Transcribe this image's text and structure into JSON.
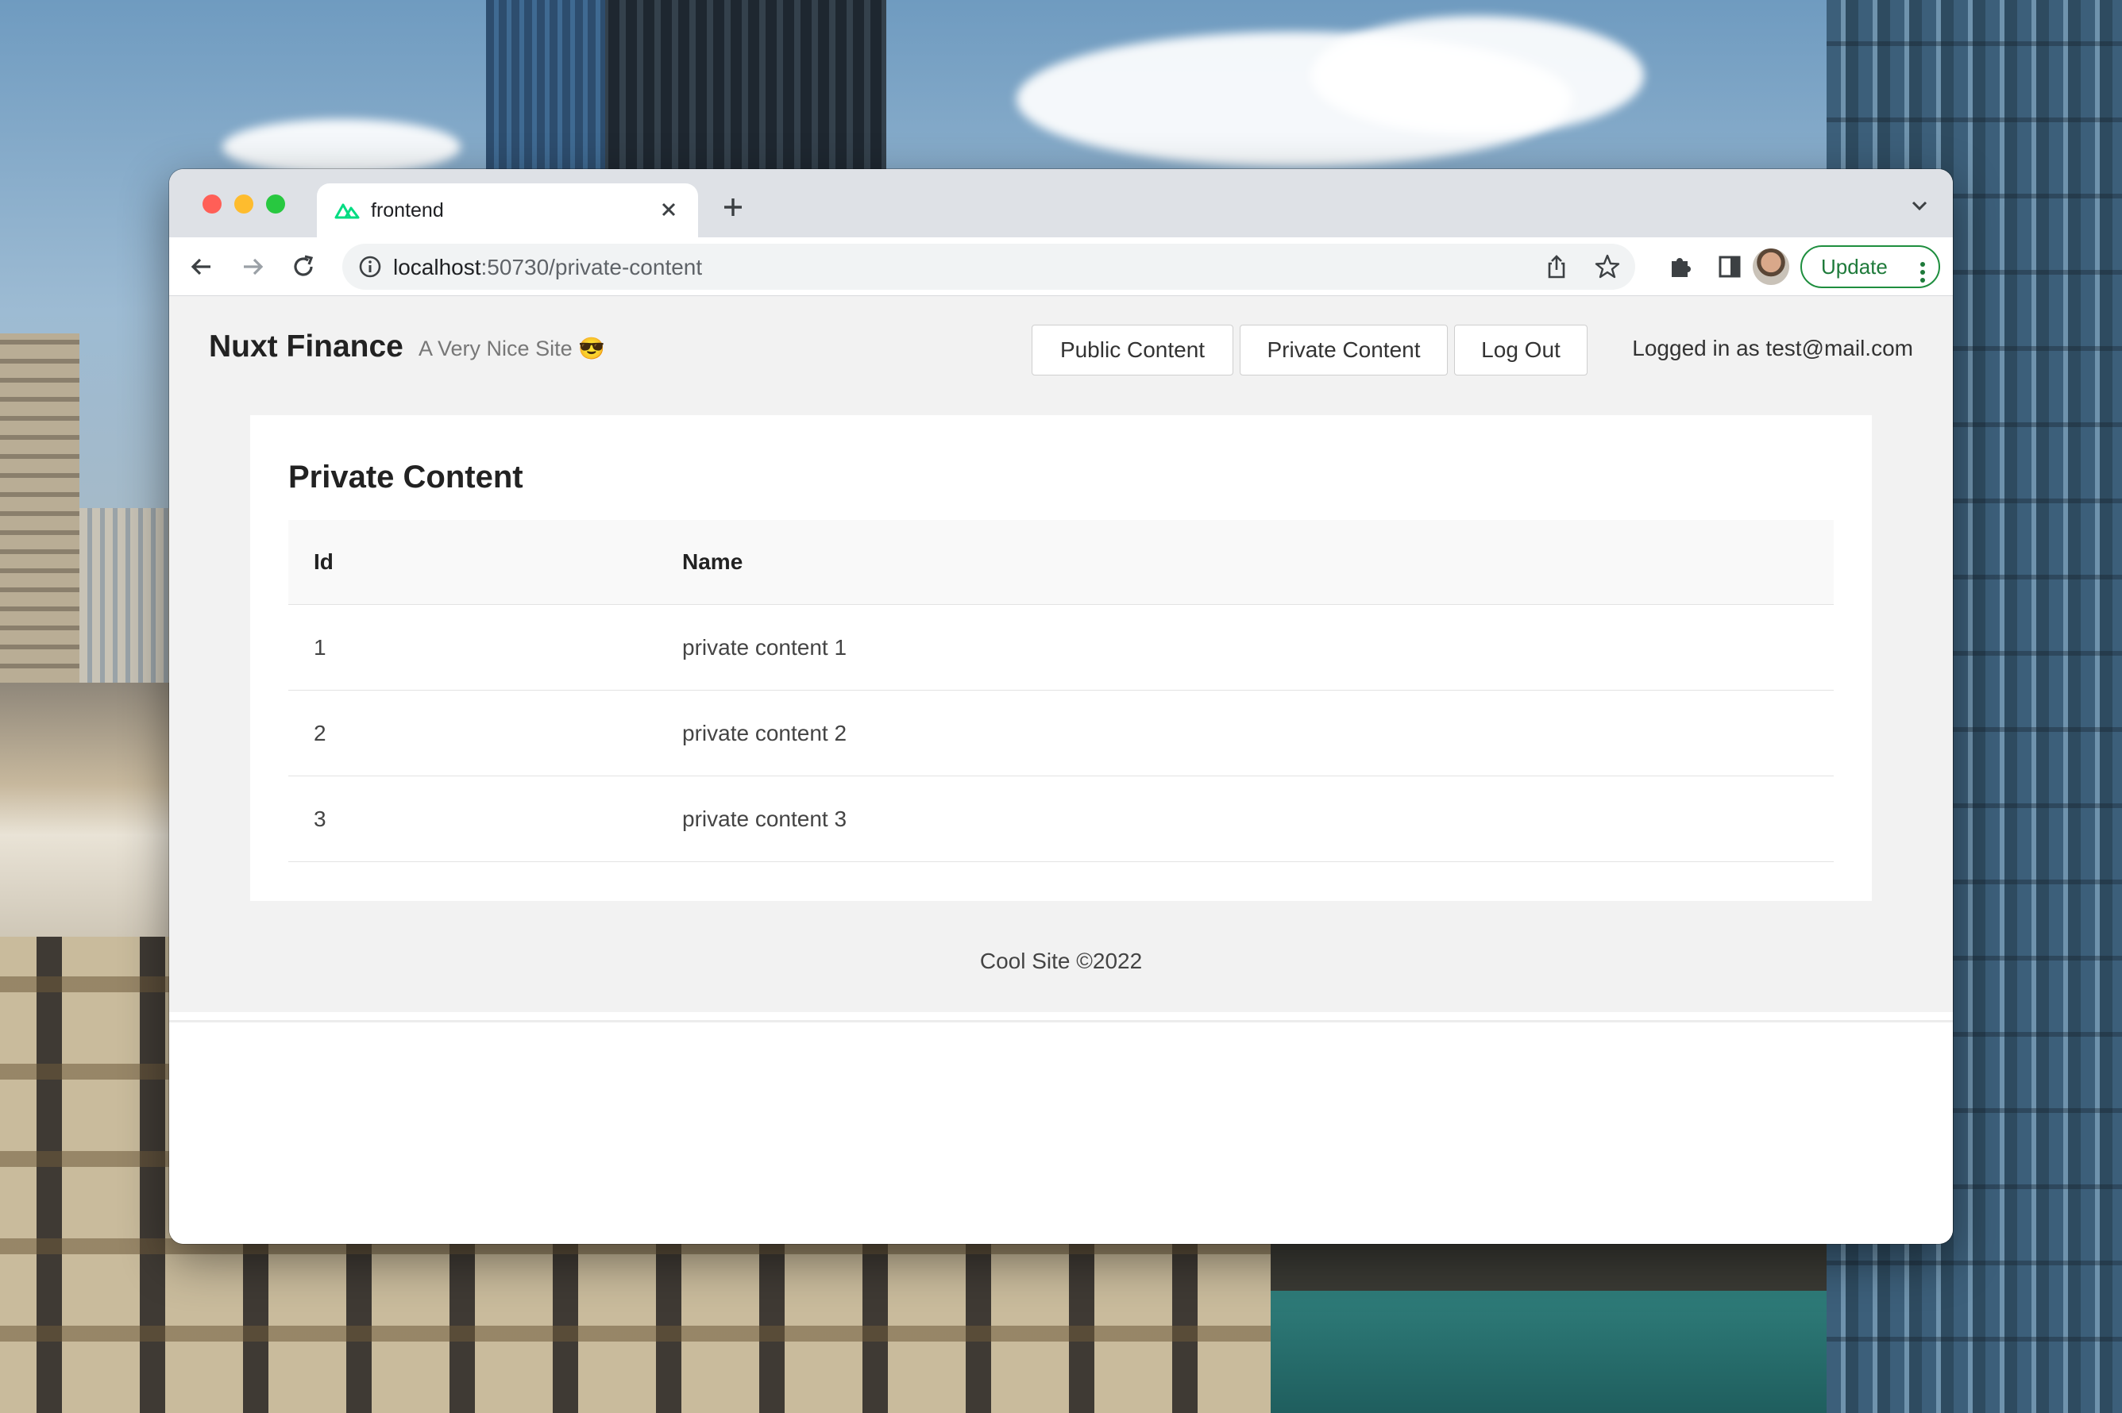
{
  "browser": {
    "tab": {
      "title": "frontend",
      "favicon": "nuxt-logo-icon"
    },
    "url": {
      "host": "localhost",
      "rest": ":50730/private-content"
    },
    "update_label": "Update"
  },
  "app": {
    "brand": "Nuxt Finance",
    "tagline": "A Very Nice Site 😎",
    "nav": {
      "public": "Public Content",
      "private": "Private Content",
      "logout": "Log Out"
    },
    "logged_in": "Logged in as test@mail.com"
  },
  "content": {
    "title": "Private Content",
    "columns": [
      "Id",
      "Name"
    ],
    "rows": [
      {
        "id": "1",
        "name": "private content 1"
      },
      {
        "id": "2",
        "name": "private content 2"
      },
      {
        "id": "3",
        "name": "private content 3"
      }
    ]
  },
  "footer": "Cool Site ©2022",
  "colors": {
    "update_accent": "#1e8e3e",
    "nuxt_green": "#00dc82",
    "page_bg": "#f2f2f2"
  }
}
